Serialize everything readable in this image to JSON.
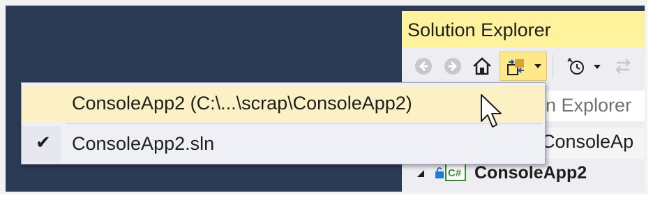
{
  "panel": {
    "title": "Solution Explorer"
  },
  "toolbar": {
    "back_icon": "back-arrow-icon",
    "forward_icon": "forward-arrow-icon",
    "home_icon": "home-icon",
    "switch_views_icon": "switch-views-icon",
    "pending_changes_icon": "history-clock-icon",
    "sync_icon": "sync-arrows-icon"
  },
  "search": {
    "placeholder_visible": "n Explorer"
  },
  "tree": {
    "row1_label": "ConsoleAp",
    "row2_label": "ConsoleApp2"
  },
  "dropdown": {
    "items": [
      {
        "label": "ConsoleApp2 (C:\\...\\scrap\\ConsoleApp2)",
        "checked": false
      },
      {
        "label": "ConsoleApp2.sln",
        "checked": true,
        "check_mark": "✔"
      }
    ]
  },
  "colors": {
    "background_dark": "#2b3a55",
    "title_yellow": "#fff29d",
    "highlight": "#fbf1c4"
  }
}
